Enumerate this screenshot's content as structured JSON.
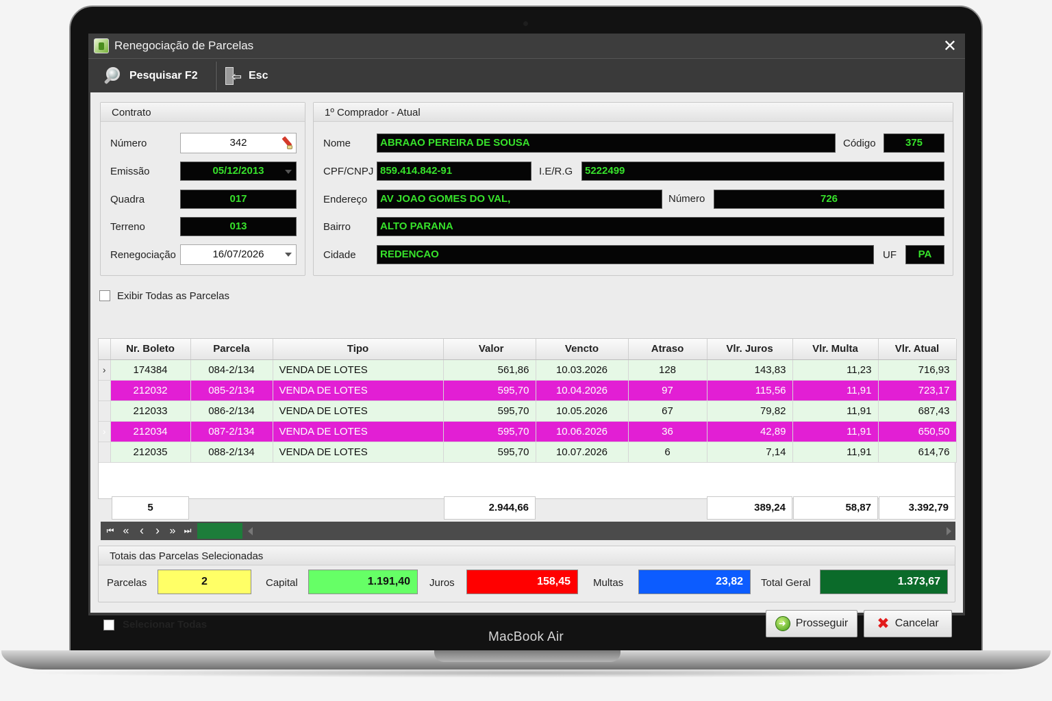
{
  "device_label": "MacBook Air",
  "window": {
    "title": "Renegociação de Parcelas"
  },
  "toolbar": {
    "search_label": "Pesquisar F2",
    "esc_label": "Esc"
  },
  "contrato": {
    "title": "Contrato",
    "numero_label": "Número",
    "numero": "342",
    "emissao_label": "Emissão",
    "emissao": "05/12/2013",
    "quadra_label": "Quadra",
    "quadra": "017",
    "terreno_label": "Terreno",
    "terreno": "013",
    "renegociacao_label": "Renegociação",
    "renegociacao": "16/07/2026"
  },
  "comprador": {
    "title": "1º Comprador - Atual",
    "nome_label": "Nome",
    "nome": "ABRAAO PEREIRA DE SOUSA",
    "codigo_label": "Código",
    "codigo": "375",
    "cpf_label": "CPF/CNPJ",
    "cpf": "859.414.842-91",
    "ie_label": "I.E/R.G",
    "ie": "5222499",
    "endereco_label": "Endereço",
    "endereco": "AV JOAO GOMES DO VAL,",
    "numero_label": "Número",
    "numero": "726",
    "bairro_label": "Bairro",
    "bairro": "ALTO PARANA",
    "cidade_label": "Cidade",
    "cidade": "REDENCAO",
    "uf_label": "UF",
    "uf": "PA"
  },
  "exibir_todas_label": "Exibir Todas as Parcelas",
  "grid": {
    "columns": [
      "Nr. Boleto",
      "Parcela",
      "Tipo",
      "Valor",
      "Vencto",
      "Atraso",
      "Vlr. Juros",
      "Vlr. Multa",
      "Vlr. Atual"
    ],
    "rows": [
      {
        "indicator": "›",
        "style": "green",
        "cells": [
          "174384",
          "084-2/134",
          "VENDA DE LOTES",
          "561,86",
          "10.03.2026",
          "128",
          "143,83",
          "11,23",
          "716,93"
        ]
      },
      {
        "indicator": "",
        "style": "magenta",
        "cells": [
          "212032",
          "085-2/134",
          "VENDA DE LOTES",
          "595,70",
          "10.04.2026",
          "97",
          "115,56",
          "11,91",
          "723,17"
        ]
      },
      {
        "indicator": "",
        "style": "green",
        "cells": [
          "212033",
          "086-2/134",
          "VENDA DE LOTES",
          "595,70",
          "10.05.2026",
          "67",
          "79,82",
          "11,91",
          "687,43"
        ]
      },
      {
        "indicator": "›",
        "style": "magenta",
        "cells": [
          "212034",
          "087-2/134",
          "VENDA DE LOTES",
          "595,70",
          "10.06.2026",
          "36",
          "42,89",
          "11,91",
          "650,50"
        ]
      },
      {
        "indicator": "",
        "style": "green",
        "cells": [
          "212035",
          "088-2/134",
          "VENDA DE LOTES",
          "595,70",
          "10.07.2026",
          "6",
          "7,14",
          "11,91",
          "614,76"
        ]
      }
    ],
    "totals": {
      "count": "5",
      "valor": "2.944,66",
      "juros": "389,24",
      "multa": "58,87",
      "atual": "3.392,79"
    }
  },
  "navigator": {
    "first": "⏮",
    "prev_page": "«",
    "prev": "‹",
    "next": "›",
    "next_page": "»",
    "last": "⏭"
  },
  "selecionadas": {
    "title": "Totais das Parcelas Selecionadas",
    "parcelas_label": "Parcelas",
    "parcelas": "2",
    "capital_label": "Capital",
    "capital": "1.191,40",
    "juros_label": "Juros",
    "juros": "158,45",
    "multas_label": "Multas",
    "multas": "23,82",
    "total_label": "Total Geral",
    "total": "1.373,67",
    "colors": {
      "parcelas": "#ffff66",
      "capital": "#66ff66",
      "juros": "#ff0000",
      "multas": "#0c5cff",
      "total": "#0b6b2a"
    }
  },
  "selecionar_todas_label": "Selecionar Todas",
  "buttons": {
    "prosseguir": "Prosseguir",
    "cancelar": "Cancelar"
  }
}
